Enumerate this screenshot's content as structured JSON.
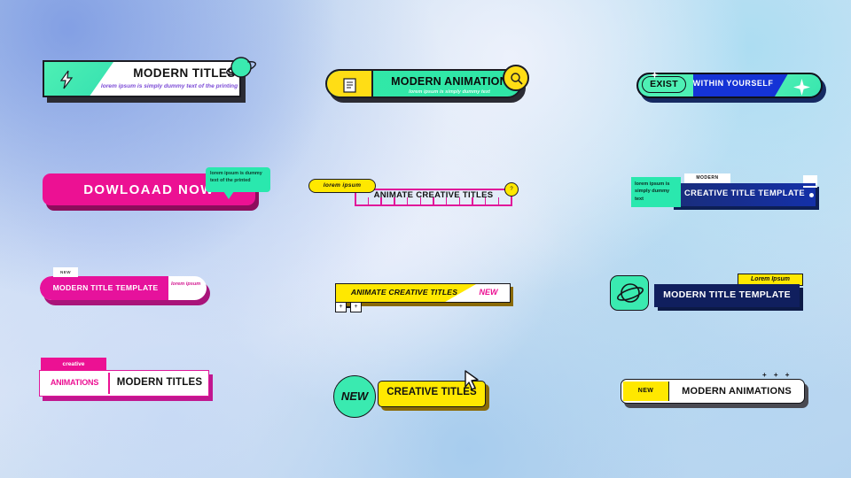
{
  "background": {
    "base_colors": [
      "#bcd3ef",
      "#cfe0f2",
      "#e2eaf6",
      "#c6dcf0",
      "#b6d2ec"
    ]
  },
  "palette": {
    "green": "#3aeab0",
    "yellow": "#ffe800",
    "pink": "#ec1193",
    "blue": "#1533d6",
    "navy": "#101f5e",
    "dark": "#141418",
    "white": "#ffffff",
    "purple_text": "#7b4ad6"
  },
  "templates": [
    {
      "id": "modern-titles",
      "title": "MODERN TITLES",
      "subtitle": "lorem ipsum is simply dummy text of the printing",
      "icon": "lightning-bolt-icon",
      "decor": "planet-icon"
    },
    {
      "id": "modern-animation",
      "title": "MODERN ANIMATION",
      "subtitle": "lorem ipsum is simply dummy text",
      "icon": "document-icon",
      "decor": "magnifier-icon"
    },
    {
      "id": "exist-within-yourself",
      "badge": "EXIST",
      "title": "WITHIN YOURSELF",
      "icon": "sparkle-icon",
      "decor": "sparkle-small-icon"
    },
    {
      "id": "dowloaad-now",
      "title": "DOWLOAAD NOW",
      "bubble": "lorem ipsum is dummy text of the printed"
    },
    {
      "id": "animate-creative-titles-ruler",
      "pill": "lorem ipsum",
      "title": "ANIMATE CREATIVE TITLES",
      "marker": "?",
      "tick_count": 13
    },
    {
      "id": "creative-title-template",
      "tab": "MODERN",
      "side_text": "lorem ipsum is simply dummy text",
      "title": "CREATIVE TITLE TEMPLATE"
    },
    {
      "id": "modern-title-template-pink",
      "tab": "NEW",
      "title": "MODERN TITLE TEMPLATE",
      "side_text": "lorem ipsum"
    },
    {
      "id": "animate-creative-titles-new",
      "title": "ANIMATE CREATIVE TITLES",
      "badge": "NEW",
      "marks": [
        "+",
        "+"
      ]
    },
    {
      "id": "modern-title-template-navy",
      "label": "Lorem Ipsum",
      "title": "MODERN TITLE TEMPLATE",
      "icon": "planet-icon"
    },
    {
      "id": "creative-animations",
      "top_label": "creative",
      "left_label": "ANIMATIONS",
      "title": "MODERN TITLES"
    },
    {
      "id": "new-creative-titles",
      "badge": "NEW",
      "title": "CREATIVE TITLES",
      "decor": "cursor-icon"
    },
    {
      "id": "new-modern-animations",
      "badge": "NEW",
      "title": "MODERN ANIMATIONS",
      "decor": "plus-marks",
      "plus_marks": "+ + +"
    }
  ]
}
